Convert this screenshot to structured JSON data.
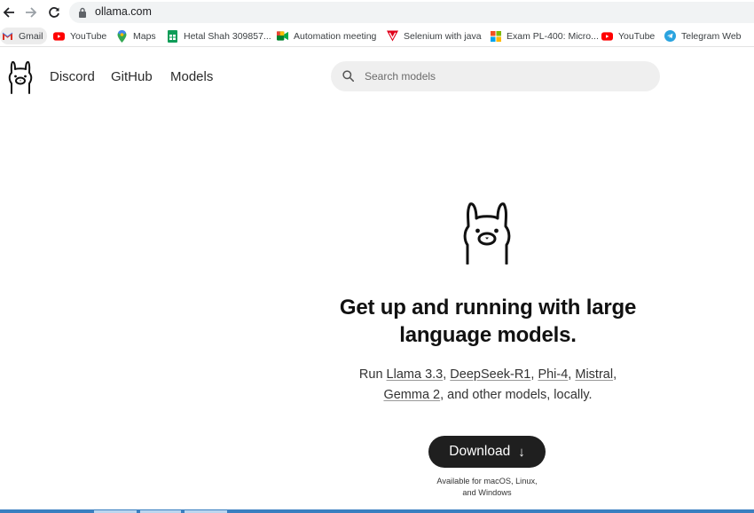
{
  "browser": {
    "url": "ollama.com",
    "bookmarks": [
      {
        "label": "Gmail",
        "icon": "gmail-icon"
      },
      {
        "label": "YouTube",
        "icon": "youtube-icon"
      },
      {
        "label": "Maps",
        "icon": "maps-icon"
      },
      {
        "label": "Hetal Shah 309857...",
        "icon": "sheets-icon"
      },
      {
        "label": "Automation meeting",
        "icon": "meet-icon"
      },
      {
        "label": "Selenium with java",
        "icon": "selenium-icon"
      },
      {
        "label": "Exam PL-400: Micro...",
        "icon": "microsoft-icon"
      },
      {
        "label": "YouTube",
        "icon": "youtube-icon"
      },
      {
        "label": "Telegram Web",
        "icon": "telegram-icon"
      }
    ]
  },
  "header": {
    "nav": [
      "Discord",
      "GitHub",
      "Models"
    ],
    "search_placeholder": "Search models"
  },
  "hero": {
    "title_line1": "Get up and running with large",
    "title_line2": "language models.",
    "sub_prefix": "Run ",
    "models": [
      "Llama 3.3",
      "DeepSeek-R1",
      "Phi-4",
      "Mistral",
      "Gemma 2"
    ],
    "sub_suffix": ", and other models, locally.",
    "download_label": "Download",
    "download_arrow": "↓",
    "available_line1": "Available for macOS, Linux,",
    "available_line2": "and Windows"
  },
  "colors": {
    "button_bg": "#1f1f1f",
    "search_bg": "#efefef",
    "url_bar_bg": "#f1f3f4"
  }
}
